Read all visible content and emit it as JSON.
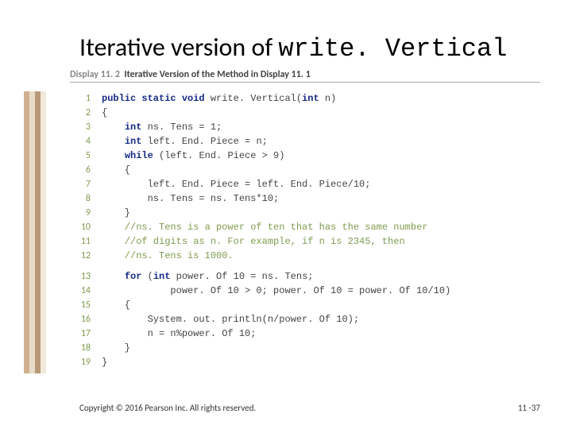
{
  "title_pre": "Iterative version of ",
  "title_mono": "write. Vertical",
  "display_label": "Display 11. 2",
  "display_title": "Iterative Version of the Method in Display 11. 1",
  "code": {
    "numbers": [
      "1",
      "2",
      "3",
      "4",
      "5",
      "6",
      "7",
      "8",
      "9",
      "10",
      "11",
      "12",
      "13",
      "14",
      "15",
      "16",
      "17",
      "18",
      "19"
    ],
    "lines": [
      {
        "i": 0,
        "t": [
          {
            "c": "kw",
            "s": "public static void"
          },
          {
            "s": " write. Vertical("
          },
          {
            "c": "kw",
            "s": "int"
          },
          {
            "s": " n)"
          }
        ]
      },
      {
        "i": 1,
        "t": [
          {
            "s": "{"
          }
        ]
      },
      {
        "i": 2,
        "t": [
          {
            "s": "    "
          },
          {
            "c": "kw",
            "s": "int"
          },
          {
            "s": " ns. Tens = 1;"
          }
        ]
      },
      {
        "i": 3,
        "t": [
          {
            "s": "    "
          },
          {
            "c": "kw",
            "s": "int"
          },
          {
            "s": " left. End. Piece = n;"
          }
        ]
      },
      {
        "i": 4,
        "t": [
          {
            "s": "    "
          },
          {
            "c": "kw",
            "s": "while"
          },
          {
            "s": " (left. End. Piece > 9)"
          }
        ]
      },
      {
        "i": 5,
        "t": [
          {
            "s": "    {"
          }
        ]
      },
      {
        "i": 6,
        "t": [
          {
            "s": "        left. End. Piece = left. End. Piece/10;"
          }
        ]
      },
      {
        "i": 7,
        "t": [
          {
            "s": "        ns. Tens = ns. Tens*10;"
          }
        ]
      },
      {
        "i": 8,
        "t": [
          {
            "s": "    }"
          }
        ]
      },
      {
        "i": 9,
        "t": [
          {
            "c": "cm",
            "s": "    //ns. Tens is a power of ten that has the same number"
          }
        ]
      },
      {
        "i": 10,
        "t": [
          {
            "c": "cm",
            "s": "    //of digits as n. For example, if n is 2345, then"
          }
        ]
      },
      {
        "i": 11,
        "t": [
          {
            "c": "cm",
            "s": "    //ns. Tens is 1000."
          }
        ]
      },
      {
        "i": 12,
        "t": [
          {
            "s": "    "
          },
          {
            "c": "kw",
            "s": "for"
          },
          {
            "s": " ("
          },
          {
            "c": "kw",
            "s": "int"
          },
          {
            "s": " power. Of 10 = ns. Tens;"
          }
        ]
      },
      {
        "i": 13,
        "t": [
          {
            "s": "            power. Of 10 > 0; power. Of 10 = power. Of 10/10)"
          }
        ]
      },
      {
        "i": 14,
        "t": [
          {
            "s": "    {"
          }
        ]
      },
      {
        "i": 15,
        "t": [
          {
            "s": "        System. out. println(n/power. Of 10);"
          }
        ]
      },
      {
        "i": 16,
        "t": [
          {
            "s": "        n = n%power. Of 10;"
          }
        ]
      },
      {
        "i": 17,
        "t": [
          {
            "s": "    }"
          }
        ]
      },
      {
        "i": 18,
        "t": [
          {
            "s": "}"
          }
        ]
      }
    ]
  },
  "footer_left": "Copyright © 2016 Pearson Inc. All rights reserved.",
  "footer_right": "11 -37"
}
